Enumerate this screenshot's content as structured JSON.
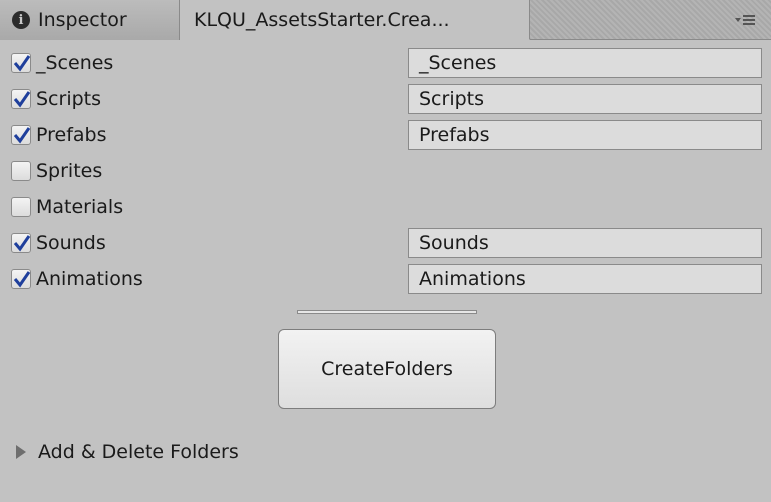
{
  "tabs": [
    {
      "label": "Inspector",
      "icon": "info-icon",
      "active": false
    },
    {
      "label": "KLQU_AssetsStarter.Crea...",
      "active": true
    }
  ],
  "folders": [
    {
      "label": "_Scenes",
      "checked": true,
      "value": "_Scenes"
    },
    {
      "label": "Scripts",
      "checked": true,
      "value": "Scripts"
    },
    {
      "label": "Prefabs",
      "checked": true,
      "value": "Prefabs"
    },
    {
      "label": "Sprites",
      "checked": false,
      "value": null
    },
    {
      "label": "Materials",
      "checked": false,
      "value": null
    },
    {
      "label": "Sounds",
      "checked": true,
      "value": "Sounds"
    },
    {
      "label": "Animations",
      "checked": true,
      "value": "Animations"
    }
  ],
  "create_button": {
    "label": "CreateFolders"
  },
  "foldout": {
    "label": "Add & Delete Folders",
    "expanded": false
  },
  "colors": {
    "panel_bg": "#c2c2c2",
    "field_bg": "#dcdcdc",
    "checkmark": "#1f3f9c"
  }
}
